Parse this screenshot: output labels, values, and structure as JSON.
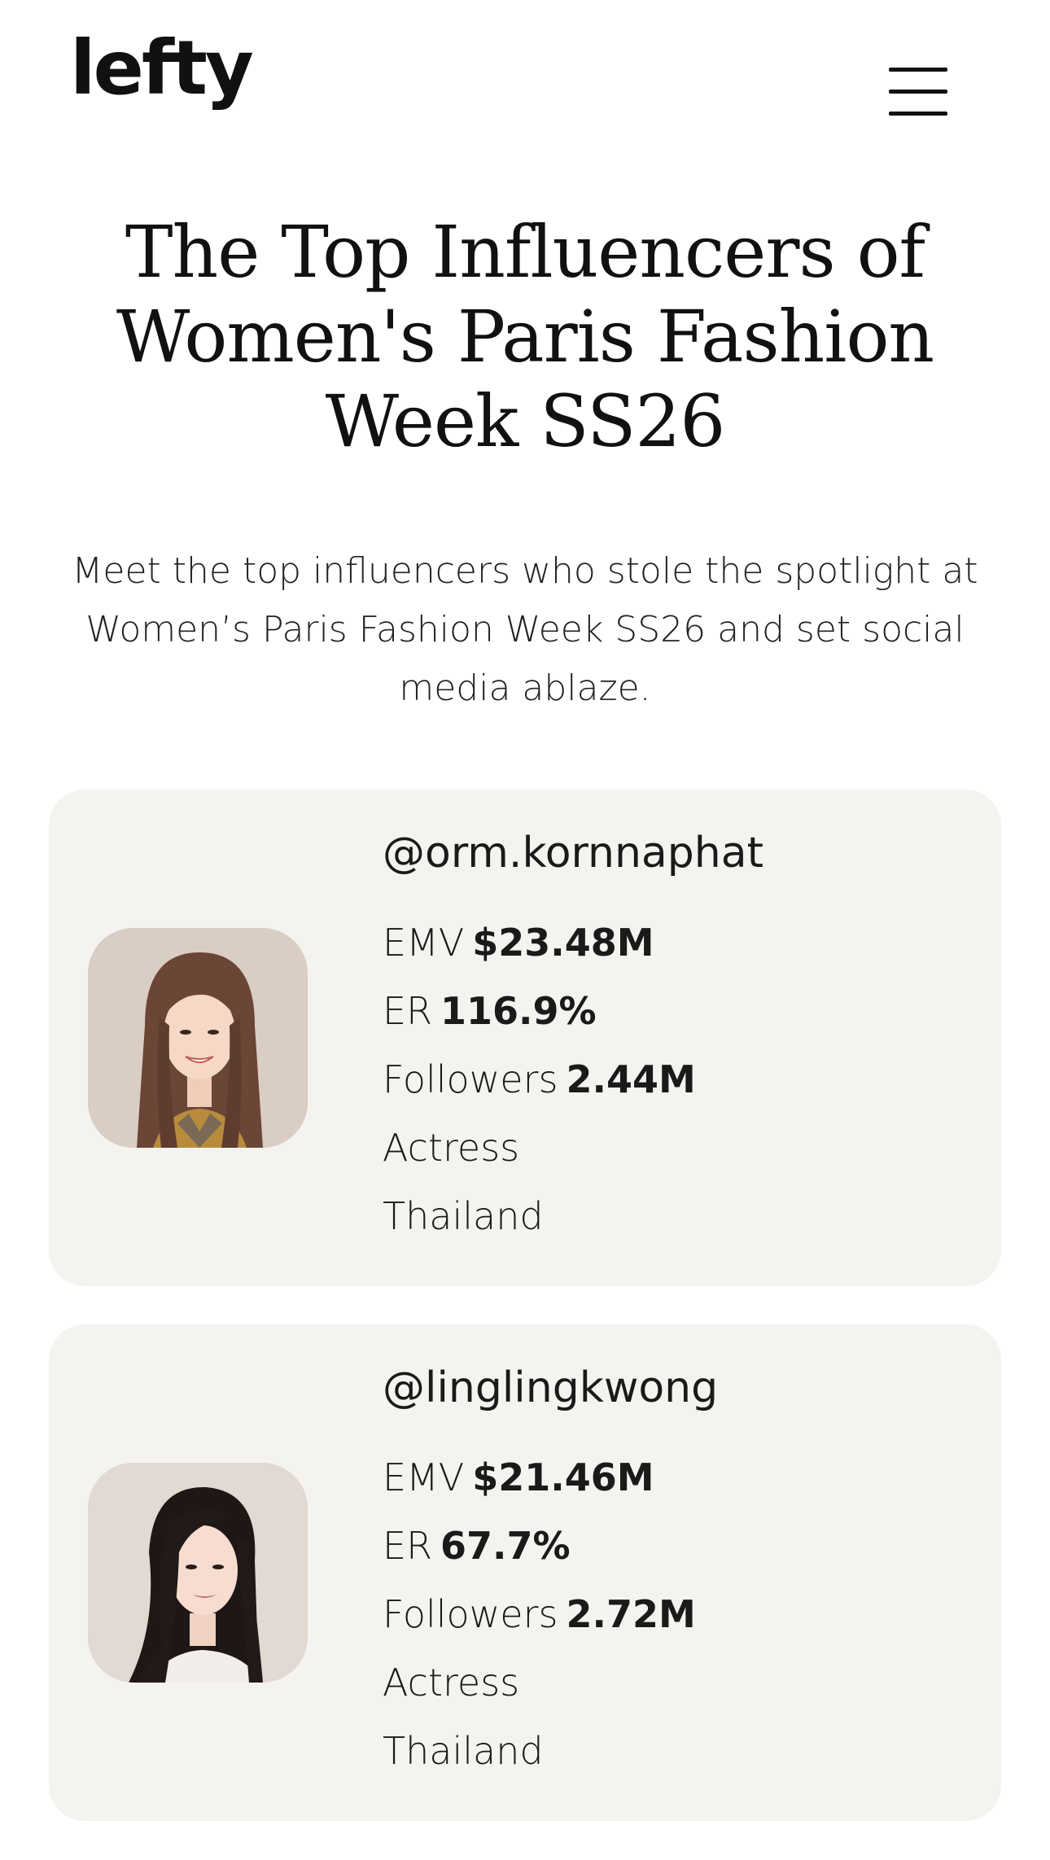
{
  "header": {
    "logo_text": "lefty",
    "menu_icon": "hamburger-menu-icon"
  },
  "page": {
    "title": "The Top Influencers of Women's Paris Fashion Week SS26",
    "subtitle": "Meet the top influencers who stole the spotlight at Women’s Paris Fashion Week SS26 and set social media ablaze."
  },
  "influencers": [
    {
      "handle": "@orm.kornnaphat",
      "emv_label": "EMV",
      "emv_value": "$23.48M",
      "er_label": "ER",
      "er_value": "116.9%",
      "followers_label": "Followers",
      "followers_value": "2.44M",
      "category": "Actress",
      "country": "Thailand"
    },
    {
      "handle": "@linglingkwong",
      "emv_label": "EMV",
      "emv_value": "$21.46M",
      "er_label": "ER",
      "er_value": "67.7%",
      "followers_label": "Followers",
      "followers_value": "2.72M",
      "category": "Actress",
      "country": "Thailand"
    }
  ],
  "colors": {
    "card_background": "#f4f3f0",
    "text": "#1a1a1a"
  }
}
